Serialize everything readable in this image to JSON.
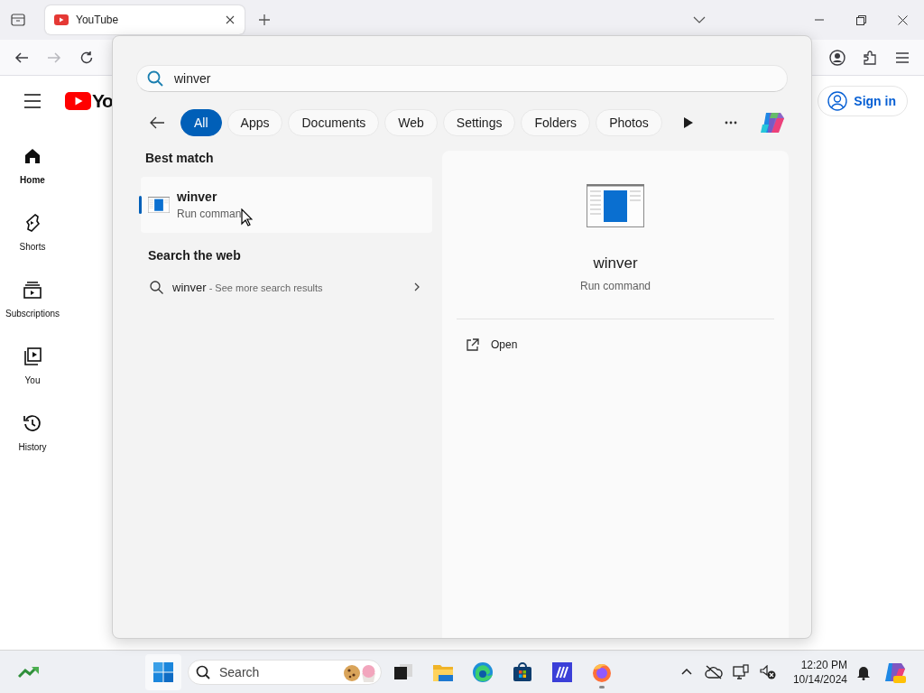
{
  "browser": {
    "tabs": [
      {
        "title": "YouTube",
        "selected": true
      }
    ],
    "nav": {
      "back_disabled": false,
      "forward_disabled": true
    }
  },
  "youtube": {
    "logo_text": "Yo",
    "sign_in": "Sign in",
    "sidebar": [
      {
        "kind": "home",
        "label": "Home",
        "selected": true
      },
      {
        "kind": "shorts",
        "label": "Shorts",
        "selected": false
      },
      {
        "kind": "subscriptions",
        "label": "Subscriptions",
        "selected": false
      },
      {
        "kind": "you",
        "label": "You",
        "selected": false
      },
      {
        "kind": "history",
        "label": "History",
        "selected": false
      }
    ]
  },
  "search_flyout": {
    "query": "winver",
    "filters": [
      {
        "label": "All",
        "selected": true
      },
      {
        "label": "Apps",
        "selected": false
      },
      {
        "label": "Documents",
        "selected": false
      },
      {
        "label": "Web",
        "selected": false
      },
      {
        "label": "Settings",
        "selected": false
      },
      {
        "label": "Folders",
        "selected": false
      },
      {
        "label": "Photos",
        "selected": false
      }
    ],
    "best_match_heading": "Best match",
    "best_match": {
      "title": "winver",
      "subtitle": "Run comman",
      "selected": true
    },
    "web_heading": "Search the web",
    "web_result": {
      "query": "winver",
      "suffix": " - See more search results"
    },
    "preview": {
      "title": "winver",
      "subtitle": "Run command",
      "actions": [
        "Open"
      ]
    }
  },
  "taskbar": {
    "search_placeholder": "Search",
    "apps": [
      {
        "kind": "task_view",
        "running": false
      },
      {
        "kind": "explorer",
        "running": false
      },
      {
        "kind": "edge",
        "running": false
      },
      {
        "kind": "store",
        "running": false
      },
      {
        "kind": "app",
        "running": false
      },
      {
        "kind": "firefox",
        "running": true
      }
    ],
    "time": "12:20 PM",
    "date": "10/14/2024"
  }
}
